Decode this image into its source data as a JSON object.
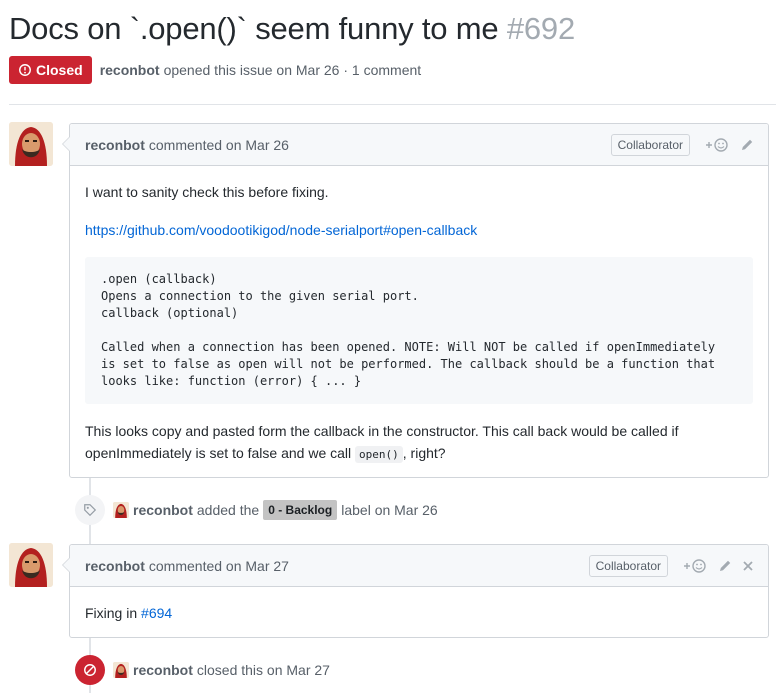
{
  "issue": {
    "title": "Docs on `.open()` seem funny to me",
    "number": "#692",
    "state": "Closed",
    "author": "reconbot",
    "meta_text": "opened this issue on Mar 26 · 1 comment"
  },
  "colors": {
    "closed_red": "#cb2431",
    "link_blue": "#0366d6",
    "label_gray": "#c3c3c3"
  },
  "comments": [
    {
      "author": "reconbot",
      "header_text": "commented on Mar 26",
      "badge": "Collaborator",
      "paragraph1": "I want to sanity check this before fixing.",
      "link": "https://github.com/voodootikigod/node-serialport#open-callback",
      "code": ".open (callback)\nOpens a connection to the given serial port.\ncallback (optional)\n\nCalled when a connection has been opened. NOTE: Will NOT be called if openImmediately\nis set to false as open will not be performed. The callback should be a function that\nlooks like: function (error) { ... }",
      "paragraph2_line1": "This looks copy and pasted form the callback in the constructor. This call back would be called if",
      "paragraph2_line2_pre": "openImmediately is set to false and we call",
      "paragraph2_code": "open()",
      "paragraph2_post": ", right?"
    },
    {
      "author": "reconbot",
      "header_text": "commented on Mar 27",
      "badge": "Collaborator",
      "body_pre": "Fixing in",
      "body_link": "#694"
    }
  ],
  "events": [
    {
      "icon": "tag-icon",
      "author": "reconbot",
      "text_pre": "added the",
      "label": "0 - Backlog",
      "text_post": "label on Mar 26"
    },
    {
      "icon": "closed-icon",
      "author": "reconbot",
      "text": "closed this on Mar 27"
    }
  ]
}
